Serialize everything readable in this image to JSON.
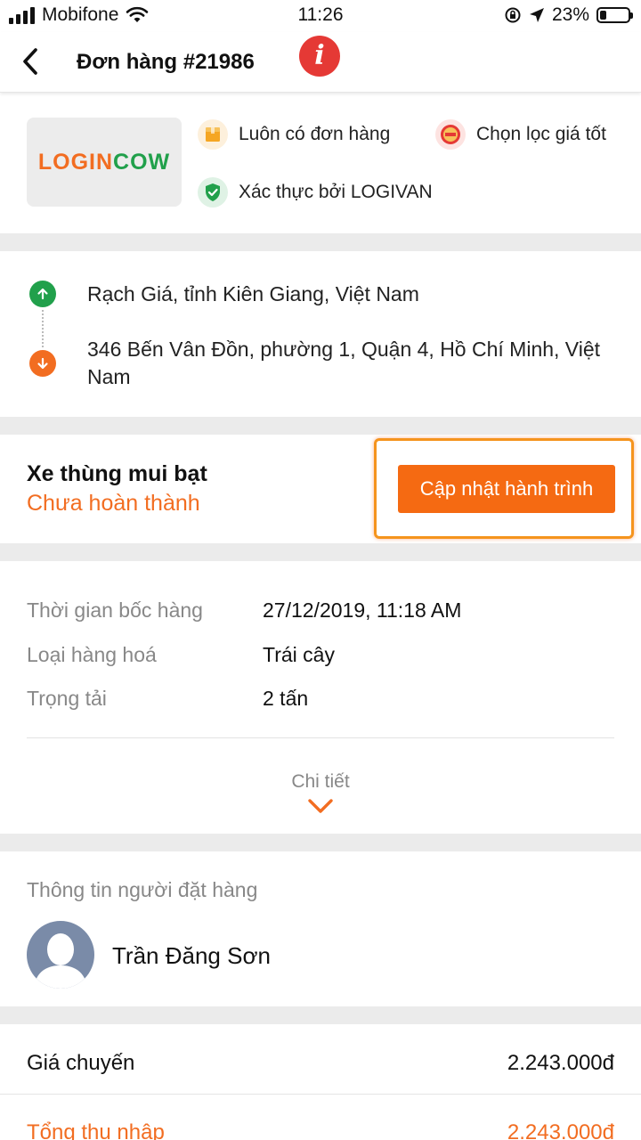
{
  "status_bar": {
    "carrier": "Mobifone",
    "time": "11:26",
    "battery_percent": "23%",
    "battery_level": 0.23
  },
  "header": {
    "title": "Đơn hàng #21986",
    "info_glyph": "i"
  },
  "company": {
    "logo_part1": "LOGIN",
    "logo_part2": "OW",
    "logo_glyph": "C",
    "badges": [
      {
        "label": "Luôn có đơn hàng",
        "icon": "package-icon",
        "color": "#f5a623"
      },
      {
        "label": "Chọn lọc giá tốt",
        "icon": "best-price-icon",
        "color": "#e53935"
      },
      {
        "label": "Xác thực bởi LOGIVAN",
        "icon": "shield-check-icon",
        "color": "#21a04b"
      }
    ]
  },
  "route": {
    "origin": "Rạch Giá, tỉnh Kiên Giang, Việt Nam",
    "destination": "346 Bến Vân Đồn, phường 1, Quận 4, Hồ Chí Minh, Việt Nam",
    "origin_color": "#21a04b",
    "destination_color": "#f26d21"
  },
  "trip": {
    "vehicle": "Xe thùng mui bạt",
    "status": "Chưa hoàn thành",
    "update_button": "Cập nhật hành trình"
  },
  "details": {
    "rows": [
      {
        "label": "Thời gian bốc hàng",
        "value": "27/12/2019, 11:18 AM"
      },
      {
        "label": "Loại hàng hoá",
        "value": "Trái cây"
      },
      {
        "label": "Trọng tải",
        "value": "2 tấn"
      }
    ],
    "more_label": "Chi tiết"
  },
  "orderer": {
    "section_title": "Thông tin người đặt hàng",
    "name": "Trần Đăng Sơn"
  },
  "pricing": {
    "price_label": "Giá chuyến",
    "price_value": "2.243.000đ",
    "income_label": "Tổng thu nhập",
    "income_value": "2.243.000đ"
  },
  "colors": {
    "accent": "#f56a12",
    "section_gap": "#ebebeb"
  }
}
